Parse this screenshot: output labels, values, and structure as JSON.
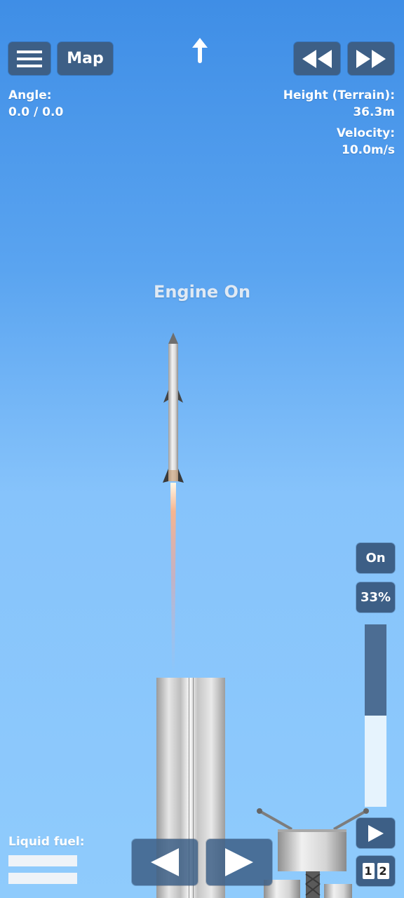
{
  "toolbar": {
    "map_label": "Map"
  },
  "telemetry": {
    "angle_label": "Angle:",
    "angle_value": "0.0 / 0.0",
    "height_label": "Height (Terrain):",
    "height_value": "36.3m",
    "velocity_label": "Velocity:",
    "velocity_value": "10.0m/s"
  },
  "status": {
    "engine": "Engine On"
  },
  "controls": {
    "engine_toggle": "On",
    "throttle_label": "33%",
    "throttle_fraction": 0.5,
    "stage_1": "1",
    "stage_2": "2"
  },
  "fuel": {
    "label": "Liquid fuel:"
  },
  "icons": [
    "menu-icon",
    "direction-arrow-icon",
    "rewind-icon",
    "fast-forward-icon",
    "rotate-left-icon",
    "rotate-right-icon",
    "play-icon"
  ]
}
